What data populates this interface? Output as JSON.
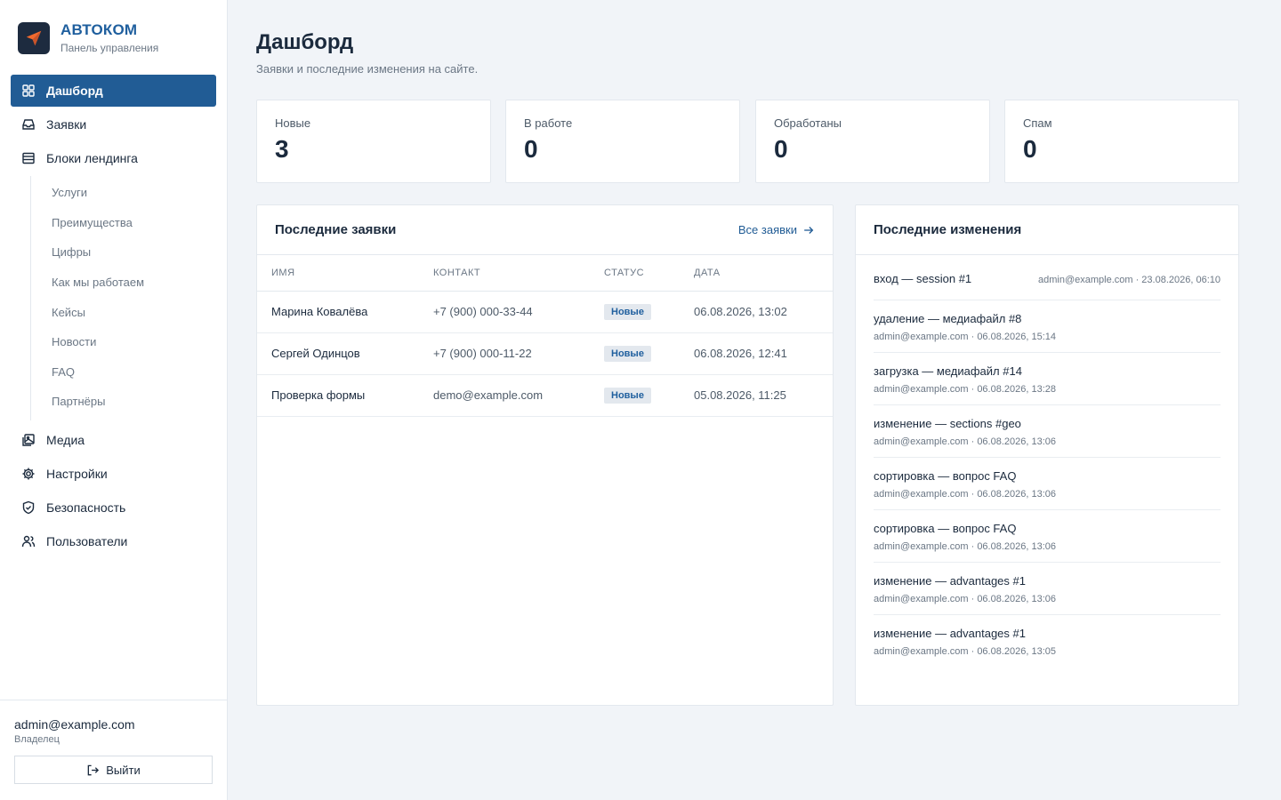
{
  "brand": {
    "name": "АВТОКОМ",
    "subtitle": "Панель управления"
  },
  "nav": {
    "items": [
      {
        "label": "Дашборд",
        "icon": "grid-icon",
        "active": true
      },
      {
        "label": "Заявки",
        "icon": "inbox-icon"
      },
      {
        "label": "Блоки лендинга",
        "icon": "layers-icon"
      }
    ],
    "subitems": [
      "Услуги",
      "Преимущества",
      "Цифры",
      "Как мы работаем",
      "Кейсы",
      "Новости",
      "FAQ",
      "Партнёры"
    ],
    "bottom_items": [
      {
        "label": "Медиа",
        "icon": "image-icon"
      },
      {
        "label": "Настройки",
        "icon": "gear-icon"
      },
      {
        "label": "Безопасность",
        "icon": "shield-icon"
      },
      {
        "label": "Пользователи",
        "icon": "users-icon"
      }
    ]
  },
  "user": {
    "email": "admin@example.com",
    "role": "Владелец",
    "logout": "Выйти"
  },
  "page": {
    "title": "Дашборд",
    "subtitle": "Заявки и последние изменения на сайте."
  },
  "stats": [
    {
      "label": "Новые",
      "value": "3"
    },
    {
      "label": "В работе",
      "value": "0"
    },
    {
      "label": "Обработаны",
      "value": "0"
    },
    {
      "label": "Спам",
      "value": "0"
    }
  ],
  "requests": {
    "title": "Последние заявки",
    "link": "Все заявки",
    "columns": [
      "ИМЯ",
      "КОНТАКТ",
      "СТАТУС",
      "ДАТА"
    ],
    "rows": [
      {
        "name": "Марина Ковалёва",
        "contact": "+7 (900) 000-33-44",
        "status": "Новые",
        "date": "06.08.2026, 13:02"
      },
      {
        "name": "Сергей Одинцов",
        "contact": "+7 (900) 000-11-22",
        "status": "Новые",
        "date": "06.08.2026, 12:41"
      },
      {
        "name": "Проверка формы",
        "contact": "demo@example.com",
        "status": "Новые",
        "date": "05.08.2026, 11:25"
      }
    ]
  },
  "changes": {
    "title": "Последние изменения",
    "items": [
      {
        "title": "вход — session #1",
        "meta": "admin@example.com · 23.08.2026, 06:10"
      },
      {
        "title": "удаление — медиафайл #8",
        "meta": "admin@example.com · 06.08.2026, 15:14"
      },
      {
        "title": "загрузка — медиафайл #14",
        "meta": "admin@example.com · 06.08.2026, 13:28"
      },
      {
        "title": "изменение — sections #geo",
        "meta": "admin@example.com · 06.08.2026, 13:06"
      },
      {
        "title": "сортировка — вопрос FAQ",
        "meta": "admin@example.com · 06.08.2026, 13:06"
      },
      {
        "title": "сортировка — вопрос FAQ",
        "meta": "admin@example.com · 06.08.2026, 13:06"
      },
      {
        "title": "изменение — advantages #1",
        "meta": "admin@example.com · 06.08.2026, 13:06"
      },
      {
        "title": "изменение — advantages #1",
        "meta": "admin@example.com · 06.08.2026, 13:05"
      }
    ]
  },
  "colors": {
    "accent": "#215c95",
    "brand": "#1f5f9e",
    "logo_bg": "#1d2b3f",
    "logo_arrow": "#f26a2e"
  }
}
